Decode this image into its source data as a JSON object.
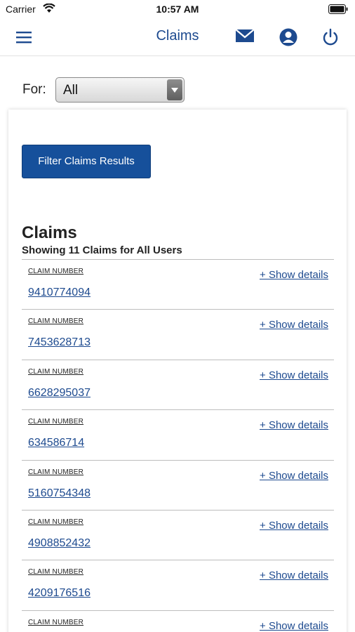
{
  "status_bar": {
    "carrier": "Carrier",
    "time": "10:57 AM"
  },
  "nav": {
    "title": "Claims",
    "icons": [
      "menu-icon",
      "mail-icon",
      "user-icon",
      "power-icon"
    ],
    "accent_color": "#1d4a8f"
  },
  "filter": {
    "for_label": "For:",
    "for_value": "All",
    "button_label": "Filter Claims Results",
    "button_color": "#16509b"
  },
  "claims": {
    "heading": "Claims",
    "summary": "Showing 11 Claims for All Users",
    "column_label": "CLAIM NUMBER",
    "details_link": "+ Show details",
    "items": [
      {
        "number": "9410774094"
      },
      {
        "number": "7453628713"
      },
      {
        "number": "6628295037"
      },
      {
        "number": "634586714"
      },
      {
        "number": "5160754348"
      },
      {
        "number": "4908852432"
      },
      {
        "number": "4209176516"
      },
      {
        "number": ""
      }
    ]
  }
}
